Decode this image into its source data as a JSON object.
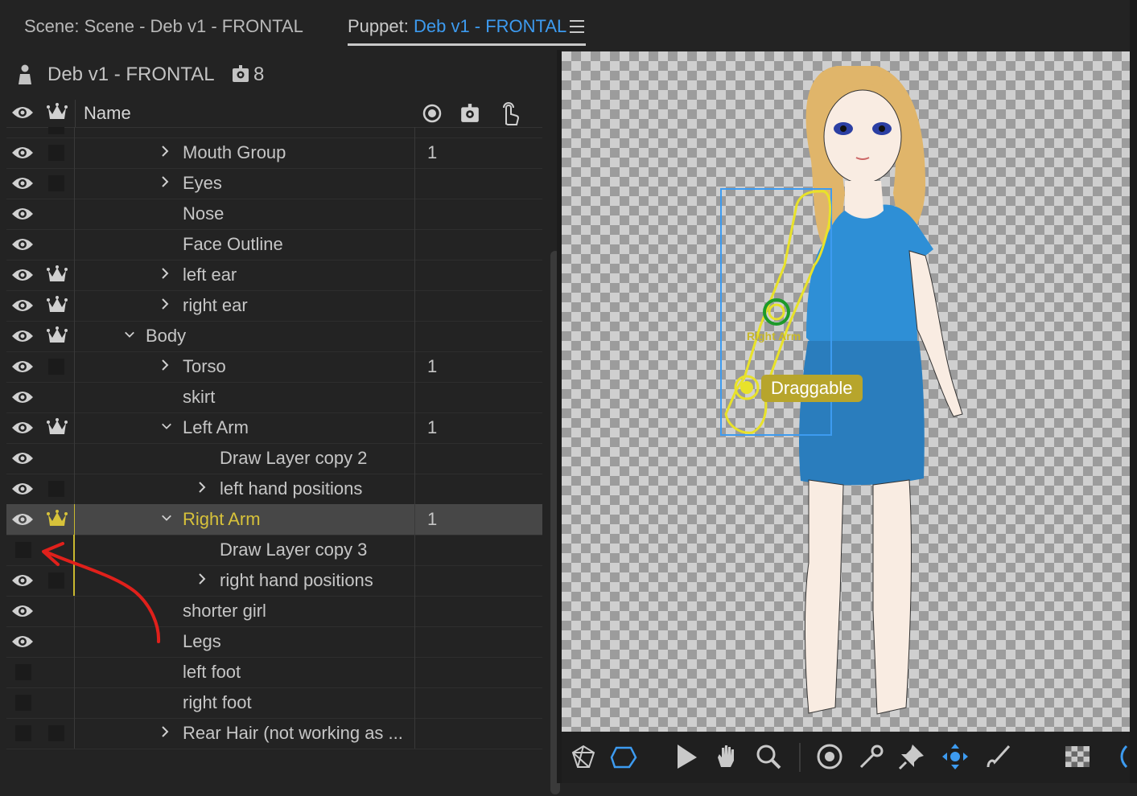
{
  "tabs": {
    "scene": "Scene: Scene - Deb v1 - FRONTAL",
    "puppet_prefix": "Puppet:",
    "puppet_name": "Deb v1 - FRONTAL"
  },
  "puppet_panel": {
    "title": "Deb v1 - FRONTAL",
    "behaviors_count": "8",
    "columns": {
      "name": "Name"
    }
  },
  "rows": [
    {
      "name": "Mouth Group",
      "count": "1"
    },
    {
      "name": "Eyes",
      "count": ""
    },
    {
      "name": "Nose",
      "count": ""
    },
    {
      "name": "Face Outline",
      "count": ""
    },
    {
      "name": "left ear",
      "count": ""
    },
    {
      "name": "right ear",
      "count": ""
    },
    {
      "name": "Body",
      "count": ""
    },
    {
      "name": "Torso",
      "count": "1"
    },
    {
      "name": "skirt",
      "count": ""
    },
    {
      "name": "Left Arm",
      "count": "1"
    },
    {
      "name": "Draw Layer copy 2",
      "count": ""
    },
    {
      "name": "left hand positions",
      "count": ""
    },
    {
      "name": "Right Arm",
      "count": "1"
    },
    {
      "name": "Draw Layer copy 3",
      "count": ""
    },
    {
      "name": "right hand positions",
      "count": ""
    },
    {
      "name": "shorter girl",
      "count": ""
    },
    {
      "name": "Legs",
      "count": ""
    },
    {
      "name": "left foot",
      "count": ""
    },
    {
      "name": "right foot",
      "count": ""
    },
    {
      "name": "Rear Hair (not working as ...",
      "count": ""
    }
  ],
  "canvas": {
    "handle_label": "Right Arm",
    "callout": "Draggable"
  },
  "colors": {
    "accent_blue": "#3d9bf0",
    "selection_gold": "#d7c23a",
    "annotation_red": "#e0201b"
  }
}
